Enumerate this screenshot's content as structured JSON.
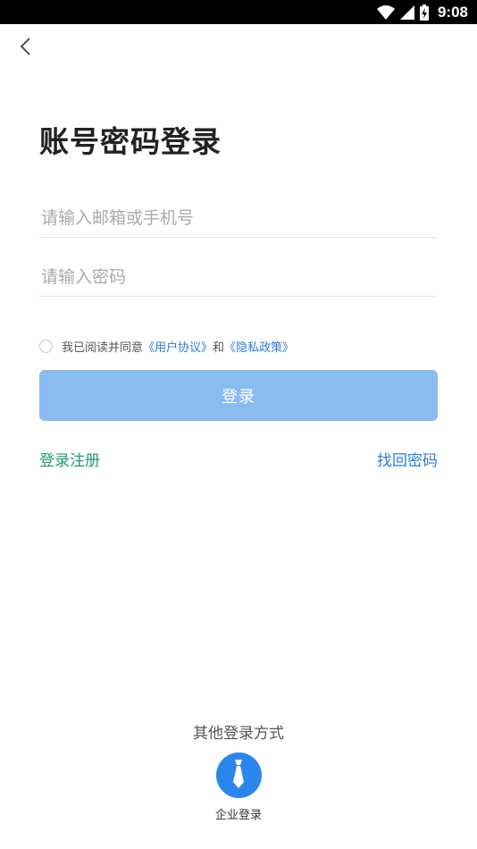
{
  "status_bar": {
    "time": "9:08",
    "icons": [
      "wifi-icon",
      "cellular-signal-icon",
      "battery-charging-icon"
    ]
  },
  "nav": {
    "back_icon": "chevron-left-icon"
  },
  "page": {
    "title": "账号密码登录"
  },
  "form": {
    "account_placeholder": "请输入邮箱或手机号",
    "account_value": "",
    "password_placeholder": "请输入密码",
    "password_value": ""
  },
  "agreement": {
    "prefix": "我已阅读并同意",
    "user_agreement": "《用户协议》",
    "conjunction": "和",
    "privacy_policy": "《隐私政策》",
    "checked": false
  },
  "actions": {
    "login_label": "登录",
    "register_label": "登录注册",
    "forgot_label": "找回密码"
  },
  "other_login": {
    "title": "其他登录方式",
    "enterprise_label": "企业登录",
    "enterprise_icon": "necktie-icon"
  },
  "colors": {
    "login_button": "#8bbcef",
    "link_blue": "#2d7bd6",
    "register_green": "#1f9b6e",
    "enterprise_circle": "#2a86ec"
  }
}
